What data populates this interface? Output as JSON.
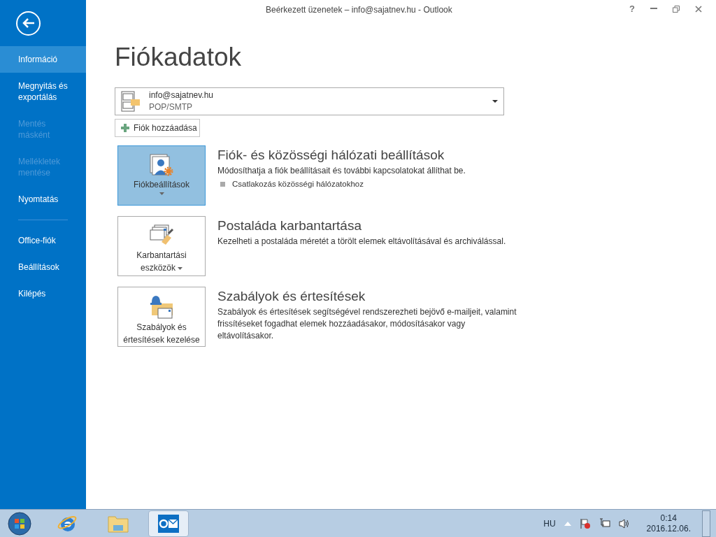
{
  "window": {
    "title": "Beérkezett üzenetek – info@sajatnev.hu - Outlook",
    "help": "?"
  },
  "sidebar": {
    "groups": [
      [
        {
          "label": "Információ",
          "selected": true,
          "disabled": false
        },
        {
          "label": "Megnyitás és exportálás",
          "selected": false,
          "disabled": false
        },
        {
          "label": "Mentés másként",
          "selected": false,
          "disabled": true
        },
        {
          "label": "Mellékletek mentése",
          "selected": false,
          "disabled": true
        },
        {
          "label": "Nyomtatás",
          "selected": false,
          "disabled": false
        }
      ],
      [
        {
          "label": "Office-fiók",
          "selected": false,
          "disabled": false
        },
        {
          "label": "Beállítások",
          "selected": false,
          "disabled": false
        },
        {
          "label": "Kilépés",
          "selected": false,
          "disabled": false
        }
      ]
    ]
  },
  "heading": "Fiókadatok",
  "account": {
    "email": "info@sajatnev.hu",
    "type": "POP/SMTP"
  },
  "add_account": "Fiók hozzáadása",
  "sections": [
    {
      "kind": "account",
      "button": "Fiókbeállítások",
      "dropdown": true,
      "selected": true,
      "title": "Fiók- és közösségi hálózati beállítások",
      "description": "Módosíthatja a fiók beállításait és további kapcsolatokat állíthat be.",
      "bullets": [
        "Csatlakozás közösségi hálózatokhoz"
      ]
    },
    {
      "kind": "maintenance",
      "button": "Karbantartási eszközök",
      "dropdown": true,
      "selected": false,
      "title": "Postaláda karbantartása",
      "description": "Kezelheti a postaláda méretét a törölt elemek eltávolításával és archiválással."
    },
    {
      "kind": "rules",
      "button": "Szabályok és értesítések kezelése",
      "dropdown": false,
      "selected": false,
      "title": "Szabályok és értesítések",
      "description": "Szabályok és értesítések segítségével rendszerezheti bejövő e-mailjeit, valamint frissítéseket fogadhat elemek hozzáadásakor, módosításakor vagy eltávolításakor."
    }
  ],
  "taskbar": {
    "apps": [
      {
        "kind": "browser",
        "selected": false
      },
      {
        "kind": "folder",
        "selected": false
      },
      {
        "kind": "outlook",
        "selected": true
      }
    ],
    "language": "HU",
    "time": "0:14",
    "date": "2016.12.06."
  }
}
